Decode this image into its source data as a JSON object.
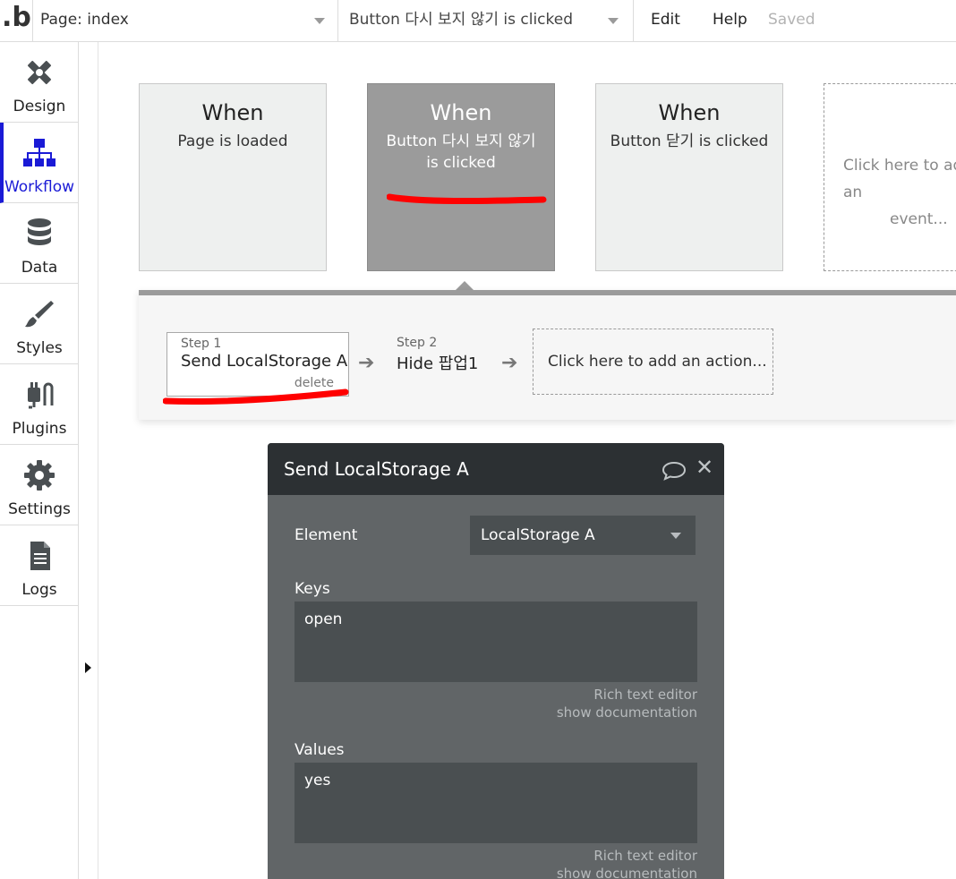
{
  "topbar": {
    "logo": "b",
    "page_selector": "Page: index",
    "event_selector": "Button 다시 보지 않기 is clicked",
    "menu_edit": "Edit",
    "menu_help": "Help",
    "save_status": "Saved"
  },
  "sidebar": {
    "items": [
      {
        "label": "Design",
        "icon": "design-icon"
      },
      {
        "label": "Workflow",
        "icon": "workflow-icon",
        "active": true
      },
      {
        "label": "Data",
        "icon": "database-icon"
      },
      {
        "label": "Styles",
        "icon": "brush-icon"
      },
      {
        "label": "Plugins",
        "icon": "plugin-icon"
      },
      {
        "label": "Settings",
        "icon": "gear-icon"
      },
      {
        "label": "Logs",
        "icon": "document-icon"
      }
    ]
  },
  "events": [
    {
      "when": "When",
      "description": "Page is loaded"
    },
    {
      "when": "When",
      "description": "Button 다시 보지 않기 is clicked",
      "selected": true
    },
    {
      "when": "When",
      "description": "Button 닫기 is clicked"
    }
  ],
  "add_event": {
    "line1": "Click here to add an",
    "line2": "event..."
  },
  "steps": [
    {
      "label": "Step 1",
      "title": "Send LocalStorage A",
      "delete": "delete"
    },
    {
      "label": "Step 2",
      "title": "Hide 팝업1"
    }
  ],
  "add_action": "Click here to add an action...",
  "editor": {
    "title": "Send LocalStorage A",
    "element_label": "Element",
    "element_value": "LocalStorage A",
    "keys_label": "Keys",
    "keys_value": "open",
    "keys_hint_1": "Rich text editor",
    "keys_hint_2": "show documentation",
    "values_label": "Values",
    "values_value": "yes",
    "values_hint_1": "Rich text editor",
    "values_hint_2": "show documentation"
  },
  "colors": {
    "accent": "#1a1ad6",
    "annotation": "#ff0000",
    "editor_bg": "#616567",
    "editor_header": "#2c3033"
  }
}
